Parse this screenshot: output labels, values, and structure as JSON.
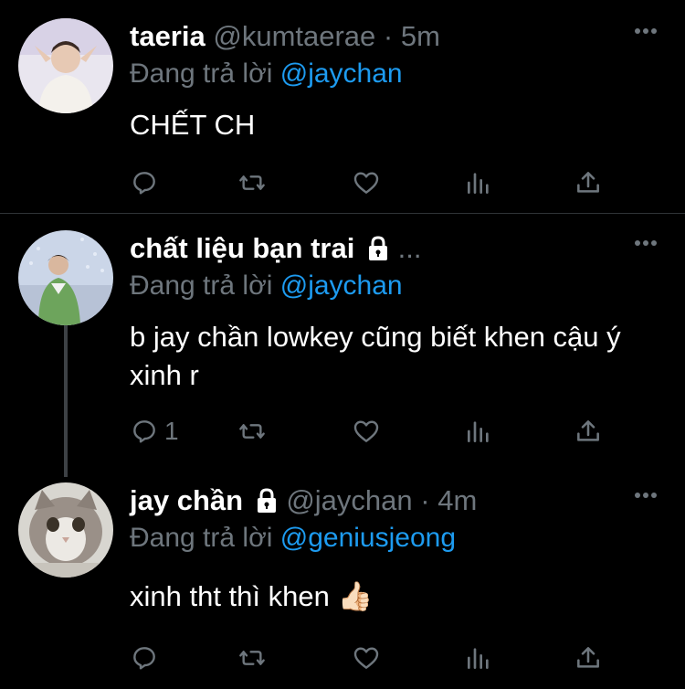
{
  "tweets": [
    {
      "name": "taeria",
      "handle": "@kumtaerae",
      "sep": "·",
      "time": "5m",
      "reply_prefix": "Đang trả lời",
      "reply_to": "@jaychan",
      "body": "CHẾT CH",
      "reply_count": "",
      "locked": false
    },
    {
      "name": "chất liệu bạn trai",
      "ellipsis": "...",
      "reply_prefix": "Đang trả lời",
      "reply_to": "@jaychan",
      "body": "b jay chần lowkey cũng biết khen cậu ý xinh r",
      "reply_count": "1",
      "locked": true
    },
    {
      "name": "jay chần",
      "handle": "@jaychan",
      "sep": "·",
      "time": "4m",
      "reply_prefix": "Đang trả lời",
      "reply_to": "@geniusjeong",
      "body": "xinh tht thì khen 👍🏻",
      "reply_count": "",
      "locked": true
    }
  ],
  "icons": [
    "reply-icon",
    "retweet-icon",
    "like-icon",
    "analytics-icon",
    "share-icon",
    "more-icon",
    "lock-icon"
  ],
  "colors": {
    "background": "#000000",
    "muted": "#6e767d",
    "link": "#1d9bf0",
    "divider": "#2f3336"
  }
}
